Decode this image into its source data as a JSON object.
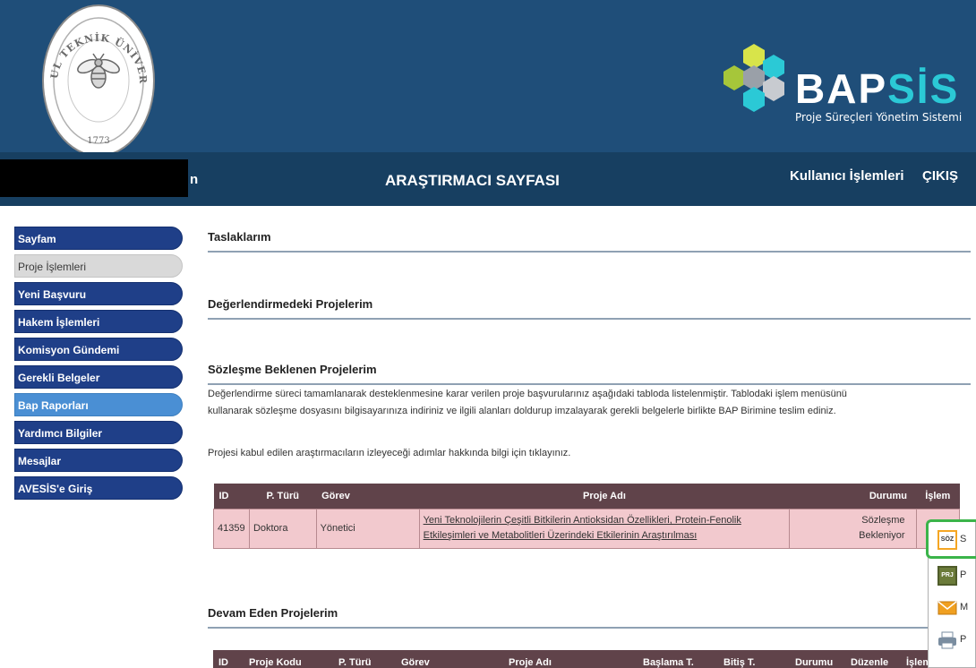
{
  "header": {
    "university_logo": {
      "text_top": "İSTANBUL TEKNİK ÜNİVERSİTESİ",
      "year": "1773"
    },
    "brand": {
      "name_part1": "BAP",
      "name_part2": "SİS",
      "subtitle": "Proje Süreçleri Yönetim Sistemi"
    }
  },
  "topbar": {
    "user_name_tail": "n",
    "page_title": "ARAŞTIRMACI SAYFASI",
    "user_ops": "Kullanıcı İşlemleri",
    "logout": "ÇIKIŞ"
  },
  "sidebar": {
    "items": [
      {
        "label": "Sayfam",
        "style": "dark"
      },
      {
        "label": "Proje İşlemleri",
        "style": "grey"
      },
      {
        "label": "Yeni Başvuru",
        "style": "dark"
      },
      {
        "label": "Hakem İşlemleri",
        "style": "dark"
      },
      {
        "label": "Komisyon Gündemi",
        "style": "dark"
      },
      {
        "label": "Gerekli Belgeler",
        "style": "dark"
      },
      {
        "label": "Bap Raporları",
        "style": "light"
      },
      {
        "label": "Yardımcı Bilgiler",
        "style": "dark"
      },
      {
        "label": "Mesajlar",
        "style": "dark"
      },
      {
        "label": "AVESİS'e Giriş",
        "style": "dark"
      }
    ]
  },
  "main": {
    "drafts_title": "Taslaklarım",
    "evaluating_title": "Değerlendirmedeki Projelerim",
    "contract_title": "Sözleşme Beklenen Projelerim",
    "contract_desc_line1": "Değerlendirme süreci tamamlanarak desteklenmesine karar verilen proje başvurularınız aşağıdaki tabloda listelenmiştir. Tablodaki işlem menüsünü",
    "contract_desc_line2": "kullanarak sözleşme dosyasını bilgisayarınıza indiriniz ve ilgili alanları doldurup imzalayarak gerekli belgelerle birlikte BAP Birimine teslim ediniz.",
    "info_note": "Projesi kabul edilen araştırmacıların izleyeceği adımlar hakkında bilgi için tıklayınız.",
    "contract_table": {
      "headers": [
        "ID",
        "P. Türü",
        "Görev",
        "Proje Adı",
        "Durumu",
        "İşlem"
      ],
      "rows": [
        {
          "id": "41359",
          "type": "Doktora",
          "role": "Yönetici",
          "name_line1": "Yeni Teknolojilerin Çeşitli Bitkilerin Antioksidan Özellikleri, Protein-Fenolik",
          "name_line2": "Etkileşimleri ve Metabolitleri Üzerindeki Etkilerinin Araştırılması",
          "status_line1": "Sözleşme",
          "status_line2": "Bekleniyor"
        }
      ]
    },
    "ongoing_title": "Devam Eden Projelerim",
    "ongoing_table": {
      "headers": [
        "ID",
        "Proje Kodu",
        "P. Türü",
        "Görev",
        "Proje Adı",
        "Başlama T.",
        "Bitiş T.",
        "Durumu",
        "Düzenle",
        "İşlem"
      ]
    }
  },
  "popup": {
    "items": [
      {
        "icon": "soz-document-icon",
        "label": "S",
        "badge": "SÖZ",
        "color": "#f5a623"
      },
      {
        "icon": "prj-document-icon",
        "label": "P",
        "badge": "PRJ",
        "color": "#6b7b3a"
      },
      {
        "icon": "mail-icon",
        "label": "M",
        "color": "#f0a020"
      },
      {
        "icon": "print-icon",
        "label": "P",
        "color": "#7a8da0"
      }
    ]
  }
}
